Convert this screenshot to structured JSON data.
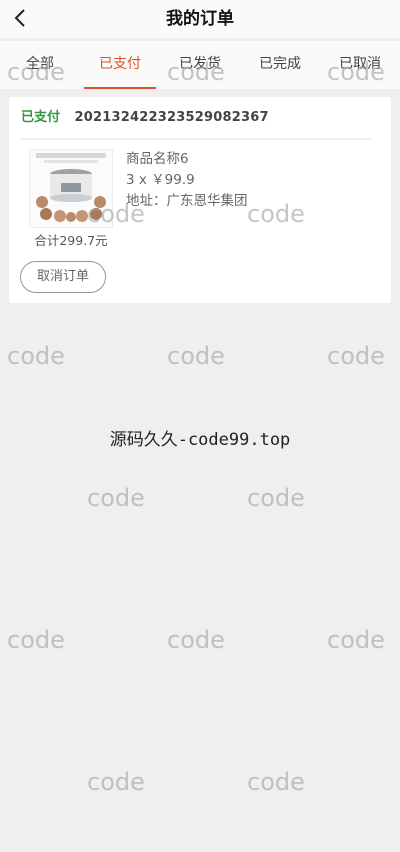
{
  "header": {
    "title": "我的订单",
    "back_icon": "chevron-left-icon"
  },
  "tabs": [
    {
      "label": "全部"
    },
    {
      "label": "已支付",
      "active": true
    },
    {
      "label": "已发货"
    },
    {
      "label": "已完成"
    },
    {
      "label": "已取消"
    }
  ],
  "colors": {
    "accent": "#d9532c",
    "paid": "#2e9a3c",
    "background": "#efefef"
  },
  "order": {
    "status": "已支付",
    "number": "2021324223235290823​67",
    "product_name": "商品名称6",
    "quantity_price": "3 x ￥99.9",
    "address": "地址：广东恩华集团",
    "total": "合计299.7元",
    "cancel_label": "取消订单"
  },
  "footer_text": "源码久久-code99.top",
  "watermark": "code"
}
